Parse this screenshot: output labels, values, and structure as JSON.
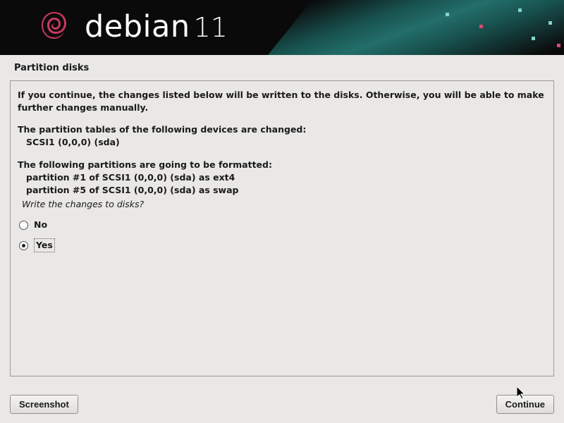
{
  "header": {
    "brand": "debian",
    "version": "11"
  },
  "page_title": "Partition disks",
  "content": {
    "warning": "If you continue, the changes listed below will be written to the disks. Otherwise, you will be able to make further changes manually.",
    "tables_heading": "The partition tables of the following devices are changed:",
    "tables_entry": "SCSI1 (0,0,0) (sda)",
    "format_heading": "The following partitions are going to be formatted:",
    "format_entry_1": "partition #1 of SCSI1 (0,0,0) (sda) as ext4",
    "format_entry_2": "partition #5 of SCSI1 (0,0,0) (sda) as swap",
    "prompt": "Write the changes to disks?"
  },
  "radio": {
    "no": "No",
    "yes": "Yes",
    "selected": "yes"
  },
  "buttons": {
    "screenshot": "Screenshot",
    "continue": "Continue"
  }
}
